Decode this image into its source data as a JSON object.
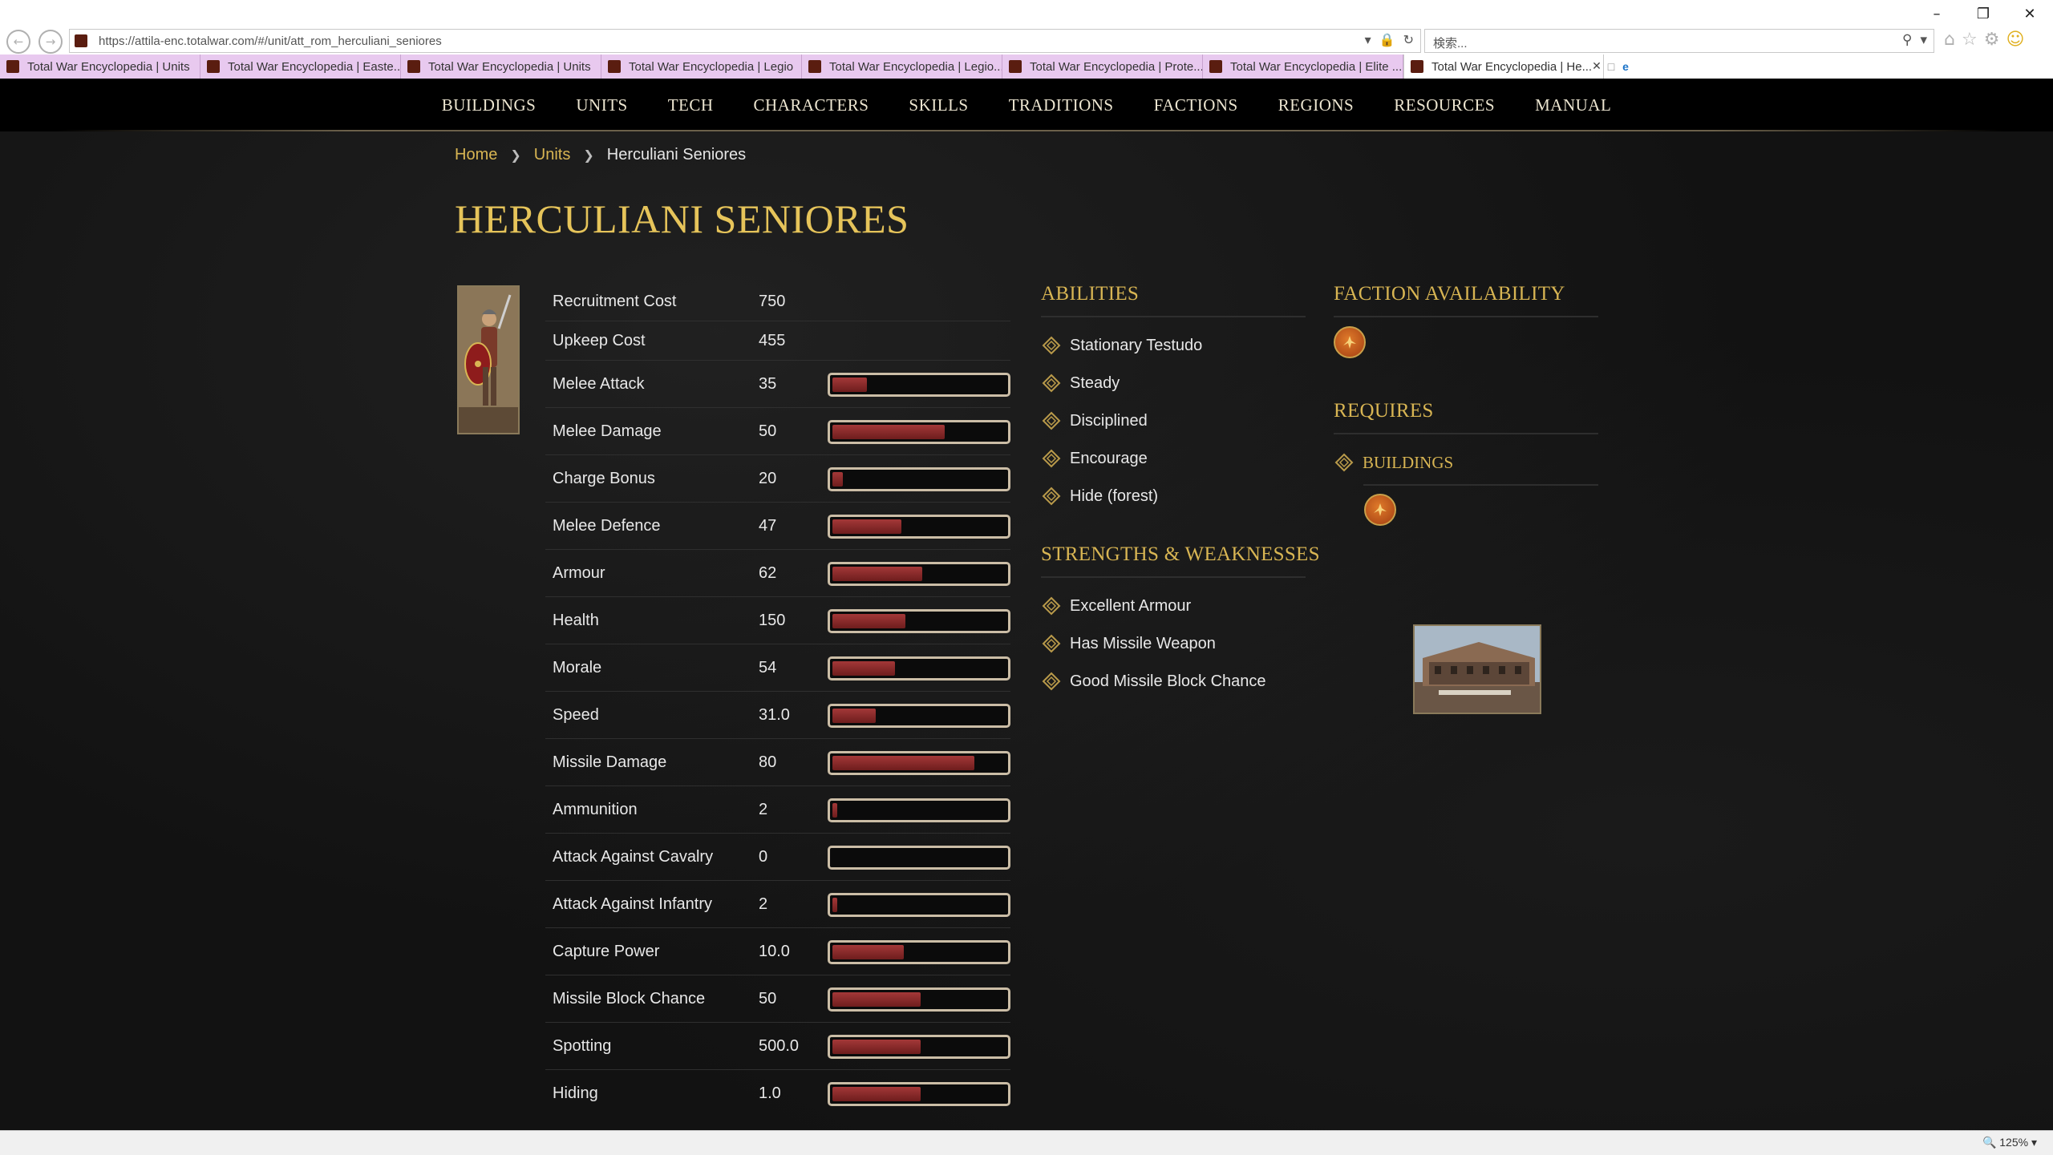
{
  "browser": {
    "url": "https://attila-enc.totalwar.com/#/unit/att_rom_herculiani_seniores",
    "search_placeholder": "検索...",
    "zoom": "125%",
    "tabs": [
      {
        "title": "Total War Encyclopedia | Units",
        "active": false
      },
      {
        "title": "Total War Encyclopedia | Easte...",
        "active": false
      },
      {
        "title": "Total War Encyclopedia | Units",
        "active": false
      },
      {
        "title": "Total War Encyclopedia | Legio",
        "active": false
      },
      {
        "title": "Total War Encyclopedia | Legio...",
        "active": false
      },
      {
        "title": "Total War Encyclopedia | Prote...",
        "active": false
      },
      {
        "title": "Total War Encyclopedia | Elite ...",
        "active": false
      },
      {
        "title": "Total War Encyclopedia | He...",
        "active": true
      }
    ]
  },
  "nav": {
    "items": [
      "BUILDINGS",
      "UNITS",
      "TECH",
      "CHARACTERS",
      "SKILLS",
      "TRADITIONS",
      "FACTIONS",
      "REGIONS",
      "RESOURCES",
      "MANUAL"
    ]
  },
  "breadcrumb": {
    "home": "Home",
    "units": "Units",
    "current": "Herculiani Seniores"
  },
  "unit": {
    "name": "HERCULIANI SENIORES",
    "stats": [
      {
        "label": "Recruitment Cost",
        "value": "750",
        "bar": null
      },
      {
        "label": "Upkeep Cost",
        "value": "455",
        "bar": null
      },
      {
        "label": "Melee Attack",
        "value": "35",
        "bar": 0.2
      },
      {
        "label": "Melee Damage",
        "value": "50",
        "bar": 0.65
      },
      {
        "label": "Charge Bonus",
        "value": "20",
        "bar": 0.06
      },
      {
        "label": "Melee Defence",
        "value": "47",
        "bar": 0.4
      },
      {
        "label": "Armour",
        "value": "62",
        "bar": 0.52
      },
      {
        "label": "Health",
        "value": "150",
        "bar": 0.42
      },
      {
        "label": "Morale",
        "value": "54",
        "bar": 0.36
      },
      {
        "label": "Speed",
        "value": "31.0",
        "bar": 0.25
      },
      {
        "label": "Missile Damage",
        "value": "80",
        "bar": 0.82
      },
      {
        "label": "Ammunition",
        "value": "2",
        "bar": 0.03
      },
      {
        "label": "Attack Against Cavalry",
        "value": "0",
        "bar": 0
      },
      {
        "label": "Attack Against Infantry",
        "value": "2",
        "bar": 0.03
      },
      {
        "label": "Capture Power",
        "value": "10.0",
        "bar": 0.41
      },
      {
        "label": "Missile Block Chance",
        "value": "50",
        "bar": 0.51
      },
      {
        "label": "Spotting",
        "value": "500.0",
        "bar": 0.51
      },
      {
        "label": "Hiding",
        "value": "1.0",
        "bar": 0.51
      }
    ]
  },
  "abilities": {
    "heading": "ABILITIES",
    "items": [
      "Stationary Testudo",
      "Steady",
      "Disciplined",
      "Encourage",
      "Hide (forest)"
    ]
  },
  "strengths": {
    "heading": "STRENGTHS & WEAKNESSES",
    "items": [
      "Excellent Armour",
      "Has Missile Weapon",
      "Good Missile Block Chance"
    ]
  },
  "faction": {
    "heading": "FACTION AVAILABILITY"
  },
  "requires": {
    "heading": "REQUIRES",
    "buildings_label": "BUILDINGS"
  },
  "colors": {
    "accent_gold": "#d8b553",
    "bar_red": "#a33838",
    "background": "#121212"
  }
}
